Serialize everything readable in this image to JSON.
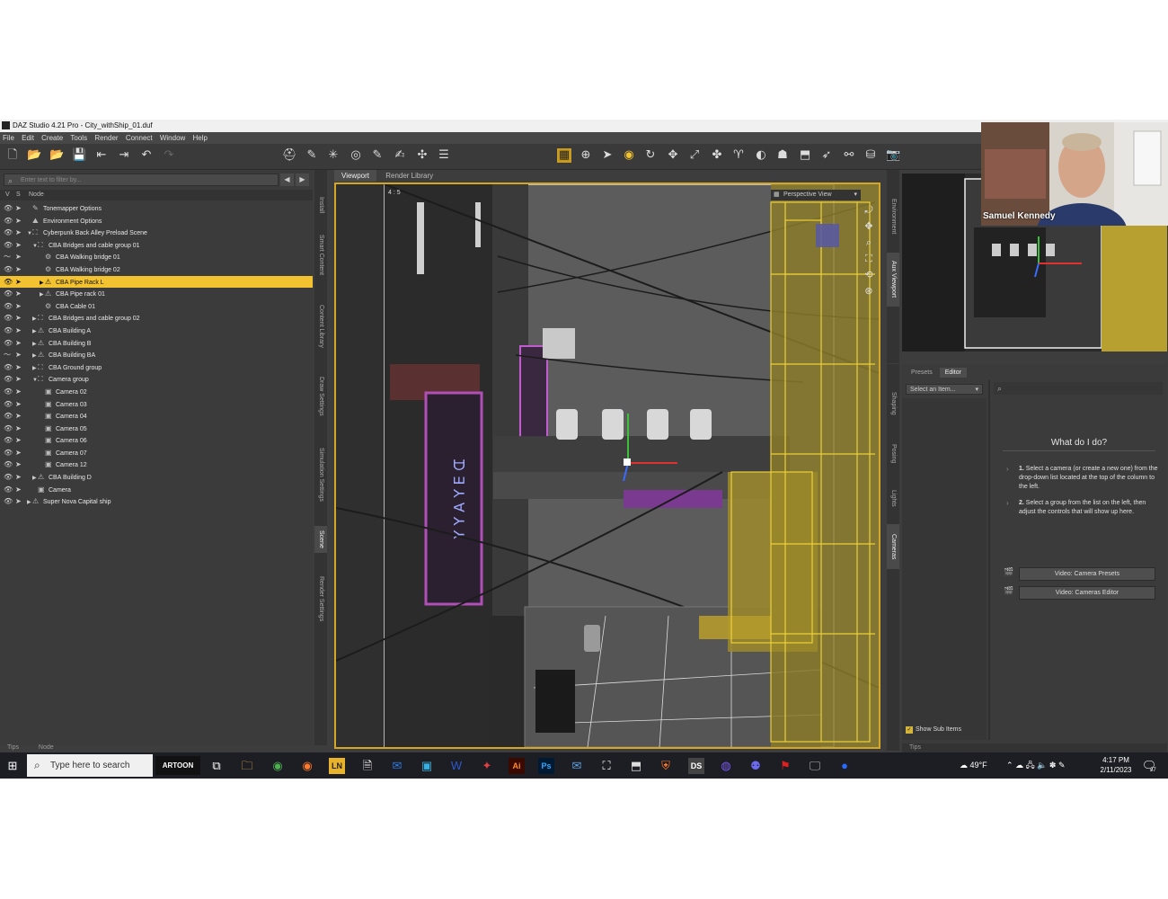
{
  "window": {
    "title": "DAZ Studio 4.21 Pro - City_withShip_01.duf"
  },
  "menu": [
    "File",
    "Edit",
    "Create",
    "Tools",
    "Render",
    "Connect",
    "Window",
    "Help"
  ],
  "scene": {
    "filter_placeholder": "Enter text to filter by...",
    "col_v": "V",
    "col_s": "S",
    "col_node": "Node",
    "nodes": [
      {
        "label": "Tonemapper Options"
      },
      {
        "label": "Environment Options"
      },
      {
        "label": "Cyberpunk Back Alley Preload Scene"
      },
      {
        "label": "CBA Bridges and cable group 01"
      },
      {
        "label": "CBA Walking bridge 01"
      },
      {
        "label": "CBA Walking bridge 02"
      },
      {
        "label": "CBA Pipe Rack L"
      },
      {
        "label": "CBA Pipe rack 01"
      },
      {
        "label": "CBA Cable 01"
      },
      {
        "label": "CBA Bridges and cable group 02"
      },
      {
        "label": "CBA Building A"
      },
      {
        "label": "CBA Building B"
      },
      {
        "label": "CBA Building BA"
      },
      {
        "label": "CBA Ground group"
      },
      {
        "label": "Camera group"
      },
      {
        "label": "Camera 02"
      },
      {
        "label": "Camera 03"
      },
      {
        "label": "Camera 04"
      },
      {
        "label": "Camera 05"
      },
      {
        "label": "Camera 06"
      },
      {
        "label": "Camera 07"
      },
      {
        "label": "Camera 12"
      },
      {
        "label": "CBA Building D"
      },
      {
        "label": "Camera"
      },
      {
        "label": "Super Nova Capital ship"
      }
    ],
    "tab_tips": "Tips",
    "tab_node": "Node"
  },
  "left_vtabs": [
    "Install",
    "Smart Content",
    "Content Library",
    "Draw Settings",
    "Simulation Settings",
    "Scene",
    "Render Settings"
  ],
  "viewport": {
    "tab_viewport": "Viewport",
    "tab_render_library": "Render Library",
    "aspect_label": "4 : 5",
    "view_select": "Perspective View"
  },
  "right_vtabs_top": [
    "Environment",
    "Aux Viewport"
  ],
  "right_vtabs_bottom": [
    "Shaping",
    "Posing",
    "Lights",
    "Cameras"
  ],
  "webcam": {
    "name": "Samuel Kennedy"
  },
  "cameras_pane": {
    "tab_presets": "Presets",
    "tab_editor": "Editor",
    "select_placeholder": "Select an Item...",
    "help_title": "What do I do?",
    "step1_num": "1.",
    "step1_text": "Select a camera (or create a new one) from the drop-down list located at the top of the column to the left.",
    "step2_num": "2.",
    "step2_text": "Select a group from the list on the left, then adjust the controls that will show up here.",
    "video_presets": "Video: Camera Presets",
    "video_editor": "Video: Cameras Editor",
    "show_sub_items": "Show Sub Items",
    "tips": "Tips"
  },
  "taskbar": {
    "search_placeholder": "Type here to search",
    "weather": "49°F",
    "time": "4:17 PM",
    "date": "2/11/2023",
    "notif_count": "27",
    "app_label_ln": "LN",
    "app_label_ai": "Ai",
    "app_label_ps": "Ps",
    "app_label_ds": "DS",
    "app_label_artoon": "ARTOON"
  },
  "colors": {
    "accent_yellow": "#f2c230",
    "viewport_border": "#d4a628",
    "panel_bg": "#3b3b3b"
  }
}
